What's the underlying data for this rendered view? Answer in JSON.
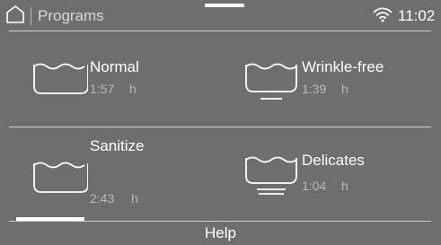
{
  "header": {
    "title": "Programs",
    "time": "11:02"
  },
  "programs": [
    {
      "name": "Normal",
      "time": "1:57",
      "unit": "h",
      "icon": "wash-tub-icon"
    },
    {
      "name": "Wrinkle-free",
      "time": "1:39",
      "unit": "h",
      "icon": "wash-tub-one-line-icon"
    },
    {
      "name": "Sanitize",
      "time": "2:43",
      "unit": "h",
      "icon": "wash-tub-icon"
    },
    {
      "name": "Delicates",
      "time": "1:04",
      "unit": "h",
      "icon": "wash-tub-two-lines-icon"
    }
  ],
  "footer": {
    "help_label": "Help"
  },
  "colors": {
    "background": "#6e6e6e",
    "divider": "#cfcfcf",
    "text": "#ffffff",
    "muted_text": "#b9b9b9"
  }
}
